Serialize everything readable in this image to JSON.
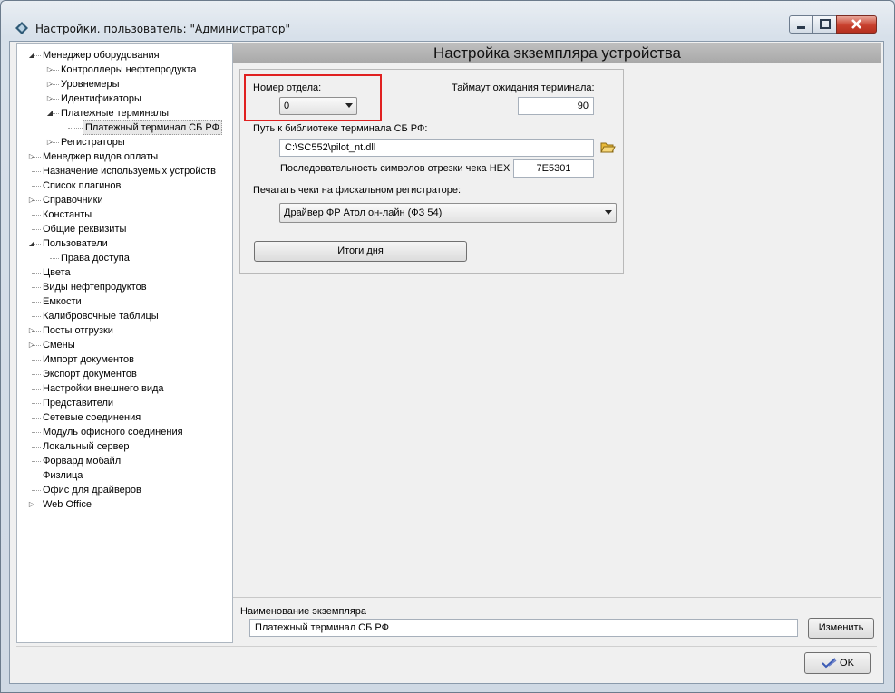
{
  "window": {
    "title": "Настройки. пользователь: \"Администратор\""
  },
  "tree": {
    "items": [
      {
        "label": "Менеджер оборудования",
        "expander": "open"
      },
      {
        "label": "Контроллеры нефтепродукта",
        "expander": "closed"
      },
      {
        "label": "Уровнемеры",
        "expander": "closed"
      },
      {
        "label": "Идентификаторы",
        "expander": "closed"
      },
      {
        "label": "Платежные терминалы",
        "expander": "open"
      },
      {
        "label": "Платежный терминал СБ РФ",
        "expander": "none"
      },
      {
        "label": "Регистраторы",
        "expander": "closed"
      },
      {
        "label": "Менеджер видов оплаты",
        "expander": "closed"
      },
      {
        "label": "Назначение используемых устройств",
        "expander": "none"
      },
      {
        "label": "Список плагинов",
        "expander": "none"
      },
      {
        "label": "Справочники",
        "expander": "closed"
      },
      {
        "label": "Константы",
        "expander": "none"
      },
      {
        "label": "Общие реквизиты",
        "expander": "none"
      },
      {
        "label": "Пользователи",
        "expander": "open"
      },
      {
        "label": "Права доступа",
        "expander": "none"
      },
      {
        "label": "Цвета",
        "expander": "none"
      },
      {
        "label": "Виды нефтепродуктов",
        "expander": "none"
      },
      {
        "label": "Емкости",
        "expander": "none"
      },
      {
        "label": "Калибровочные таблицы",
        "expander": "none"
      },
      {
        "label": "Посты отгрузки",
        "expander": "closed"
      },
      {
        "label": "Смены",
        "expander": "closed"
      },
      {
        "label": "Импорт документов",
        "expander": "none"
      },
      {
        "label": "Экспорт документов",
        "expander": "none"
      },
      {
        "label": "Настройки внешнего вида",
        "expander": "none"
      },
      {
        "label": "Представители",
        "expander": "none"
      },
      {
        "label": "Сетевые соединения",
        "expander": "none"
      },
      {
        "label": "Модуль офисного соединения",
        "expander": "none"
      },
      {
        "label": "Локальный сервер",
        "expander": "none"
      },
      {
        "label": "Форвард мобайл",
        "expander": "none"
      },
      {
        "label": "Физлица",
        "expander": "none"
      },
      {
        "label": "Офис для драйверов",
        "expander": "none"
      },
      {
        "label": "Web Office",
        "expander": "closed"
      }
    ],
    "selected_label": "Платежный терминал СБ РФ"
  },
  "panel": {
    "header": "Настройка экземпляра устройства",
    "department_label": "Номер отдела:",
    "department_value": "0",
    "timeout_label": "Таймаут ожидания терминала:",
    "timeout_value": "90",
    "library_label": "Путь к библиотеке терминала СБ РФ:",
    "library_value": "C:\\SC552\\pilot_nt.dll",
    "cut_sequence_label": "Последовательность символов отрезки чека HEX",
    "cut_sequence_value": "7E5301",
    "print_label": "Печатать чеки на фискальном регистраторе:",
    "print_value": "Драйвер ФР Атол он-лайн (ФЗ 54)",
    "day_totals_button": "Итоги дня"
  },
  "instance": {
    "name_label": "Наименование экземпляра",
    "name_value": "Платежный терминал СБ РФ",
    "change_button": "Изменить"
  },
  "footer": {
    "ok_button": "OK"
  },
  "colors": {
    "highlight": "#e02020",
    "folder_icon": "#e8b93a"
  }
}
